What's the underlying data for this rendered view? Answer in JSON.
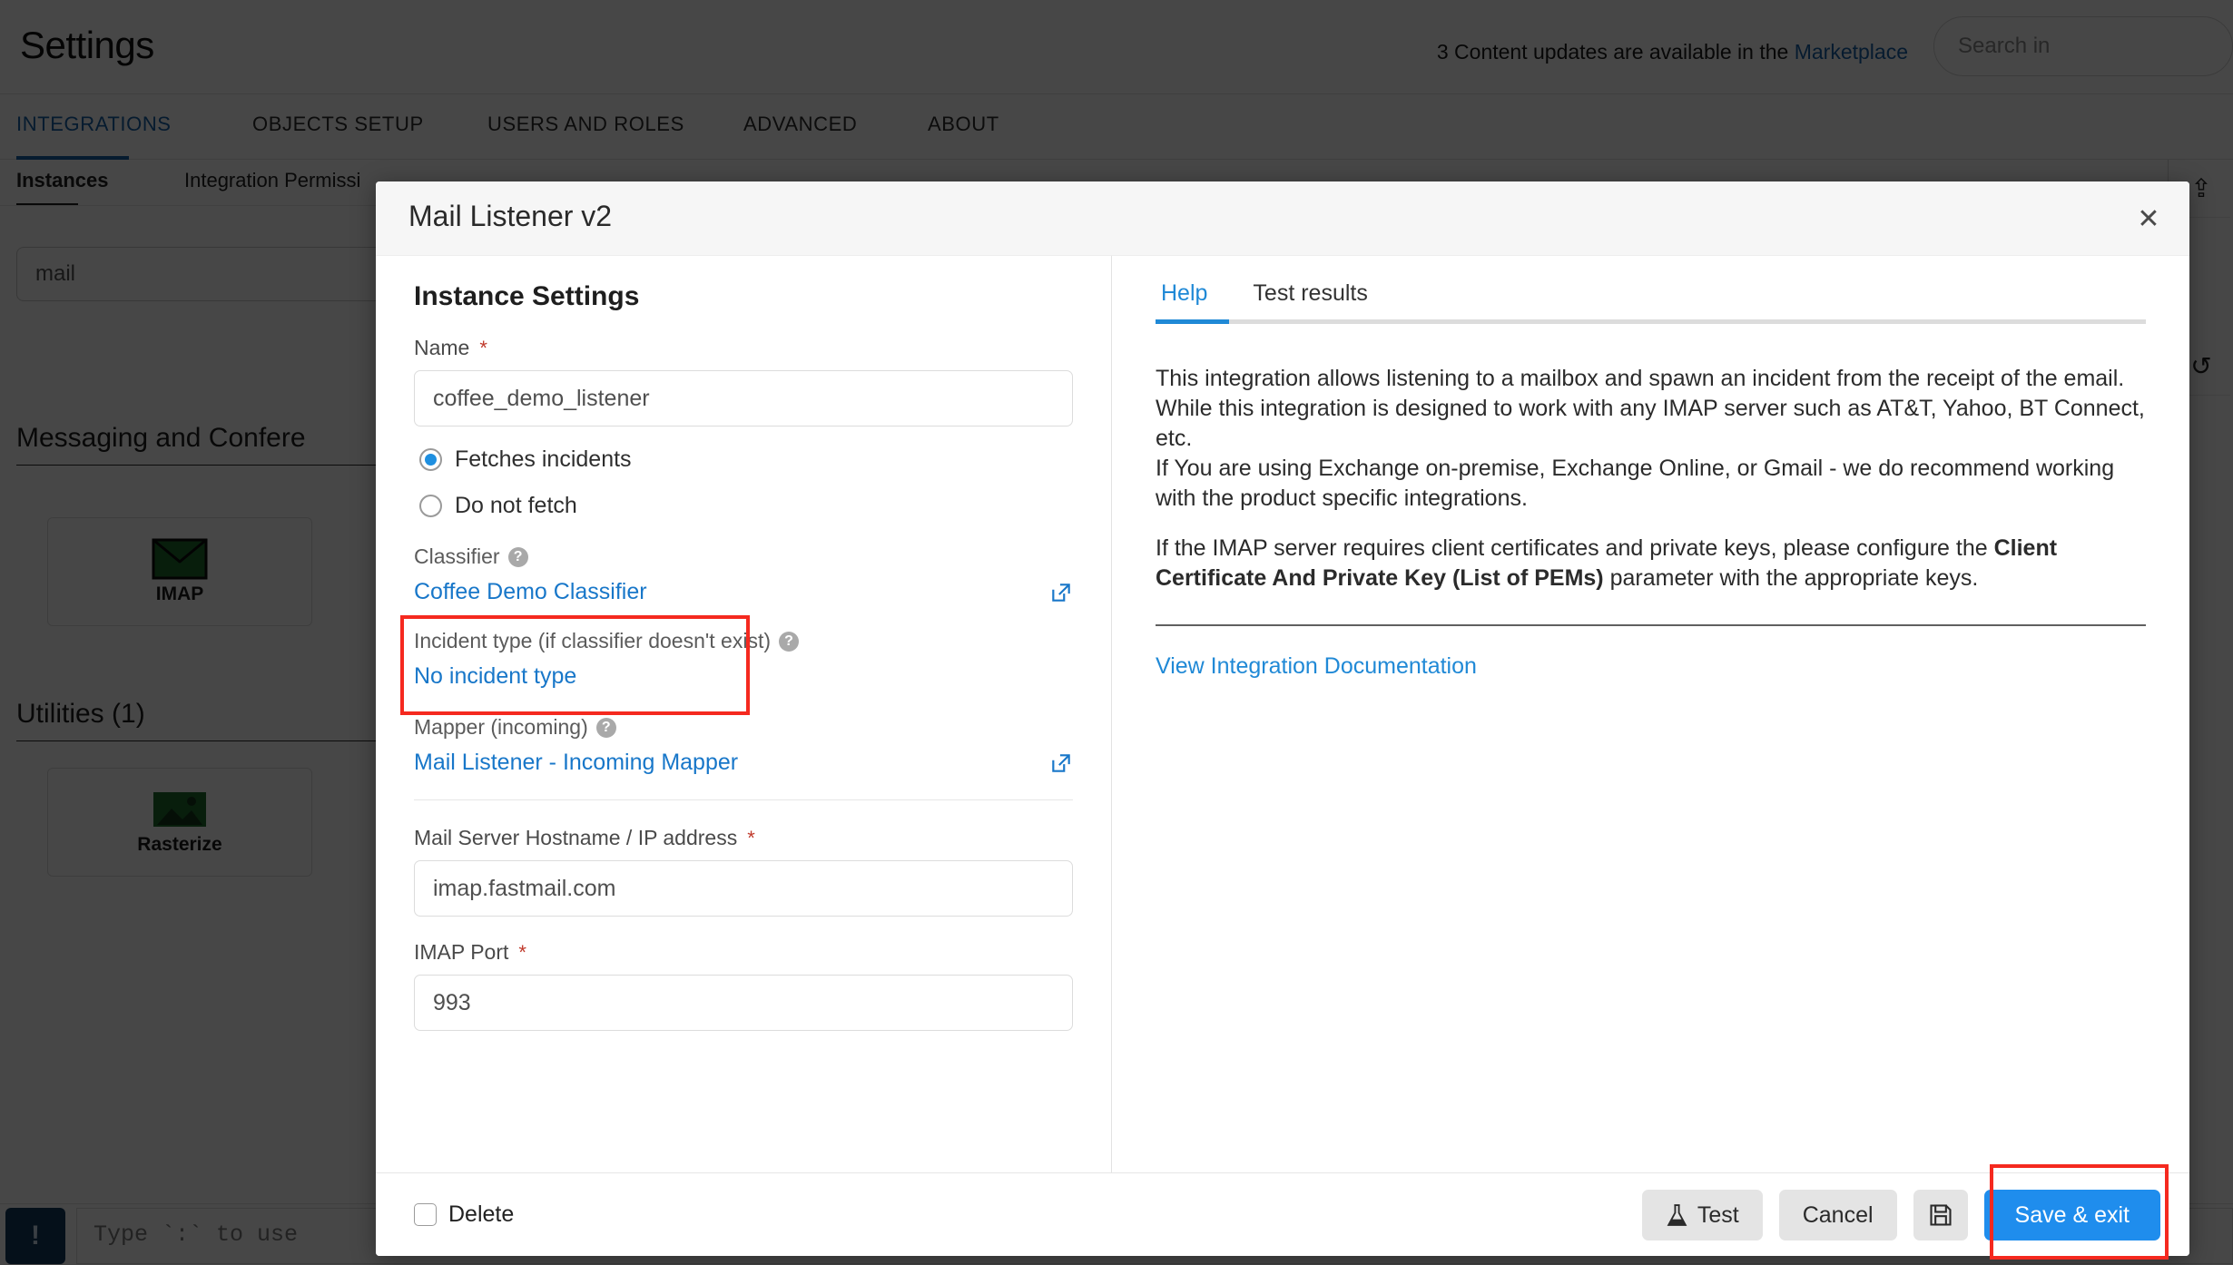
{
  "background": {
    "page_title": "Settings",
    "updates_notice": "3 Content updates are available in the ",
    "marketplace_link": "Marketplace",
    "search_placeholder": "Search in",
    "tabs": [
      {
        "label": "INTEGRATIONS",
        "active": true
      },
      {
        "label": "OBJECTS SETUP",
        "active": false
      },
      {
        "label": "USERS AND ROLES",
        "active": false
      },
      {
        "label": "ADVANCED",
        "active": false
      },
      {
        "label": "ABOUT",
        "active": false
      }
    ],
    "subtabs": [
      {
        "label": "Instances",
        "active": true
      },
      {
        "label": "Integration Permissi",
        "active": false
      }
    ],
    "filter_value": "mail",
    "sections": [
      {
        "title": "Messaging and Confere",
        "cards": [
          {
            "label": "IMAP",
            "icon": "envelope-icon"
          }
        ]
      },
      {
        "title": "Utilities (1)",
        "cards": [
          {
            "label": "Rasterize",
            "icon": "rasterize-icon"
          }
        ]
      }
    ],
    "console_prompt": "!",
    "console_placeholder": "Type `:` to use"
  },
  "modal": {
    "title": "Mail Listener v2",
    "close_label": "✕",
    "settings": {
      "heading": "Instance Settings",
      "name_label": "Name",
      "name_value": "coffee_demo_listener",
      "fetch_options": [
        {
          "label": "Fetches incidents",
          "checked": true
        },
        {
          "label": "Do not fetch",
          "checked": false
        }
      ],
      "classifier_label": "Classifier",
      "classifier_value": "Coffee Demo Classifier",
      "incident_type_label": "Incident type (if classifier doesn't exist)",
      "incident_type_value": "No incident type",
      "mapper_label": "Mapper (incoming)",
      "mapper_value": "Mail Listener - Incoming Mapper",
      "hostname_label": "Mail Server Hostname / IP address",
      "hostname_value": "imap.fastmail.com",
      "port_label": "IMAP Port",
      "port_value": "993",
      "help_glyph": "?",
      "required_marker": "*"
    },
    "help": {
      "tabs": [
        {
          "label": "Help",
          "active": true
        },
        {
          "label": "Test results",
          "active": false
        }
      ],
      "paragraph_1": "This integration allows listening to a mailbox and spawn an incident from the receipt of the email.",
      "paragraph_2": "While this integration is designed to work with any IMAP server such as AT&T, Yahoo, BT Connect, etc.",
      "paragraph_3": "If You are using Exchange on-premise, Exchange Online, or Gmail - we do recommend working with the product specific integrations.",
      "paragraph_4_pre": "If the IMAP server requires client certificates and private keys, please configure the ",
      "paragraph_4_bold": "Client Certificate And Private Key (List of PEMs)",
      "paragraph_4_post": " parameter with the appropriate keys.",
      "doc_link": "View Integration Documentation"
    },
    "footer": {
      "delete_label": "Delete",
      "test_label": "Test",
      "cancel_label": "Cancel",
      "save_label": "Save & exit"
    }
  },
  "colors": {
    "accent_blue": "#1f8ded",
    "link_blue": "#1877c9",
    "highlight_red": "#f5291f",
    "required_red": "#c0392b",
    "icon_green": "#1e6b2e"
  }
}
